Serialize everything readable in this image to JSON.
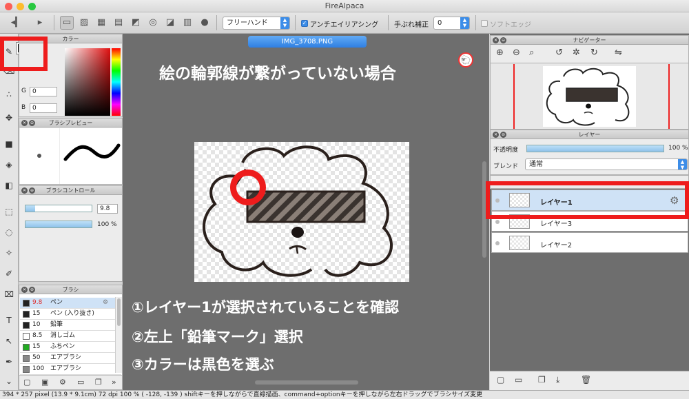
{
  "app": {
    "title": "FireAlpaca"
  },
  "toolbar": {
    "brush_mode": "フリーハンド",
    "antialias_label": "アンチエイリアシング",
    "stabilizer_label": "手ぶれ補正",
    "stabilizer_value": "0",
    "soft_edge_label": "ソフトエッジ"
  },
  "color_panel": {
    "title": "カラー",
    "g_label": "G",
    "g_value": "0",
    "b_label": "B",
    "b_value": "0",
    "foreground": "#000000",
    "background": "#ffffff"
  },
  "brush_preview": {
    "title": "ブラシプレビュー"
  },
  "brush_control": {
    "title": "ブラシコントロール",
    "size_value": "9.8",
    "opacity_value": "100 %",
    "size_level": 0.15,
    "opacity_level": 1.0
  },
  "brush_panel": {
    "title": "ブラシ",
    "items": [
      {
        "size": "9.8",
        "name": "ペン",
        "color": "#222222"
      },
      {
        "size": "15",
        "name": "ペン (入り抜き)",
        "color": "#222222"
      },
      {
        "size": "10",
        "name": "鉛筆",
        "color": "#222222"
      },
      {
        "size": "8.5",
        "name": "消しゴム",
        "color": "#ffffff"
      },
      {
        "size": "15",
        "name": "ふちペン",
        "color": "#22aa22"
      },
      {
        "size": "50",
        "name": "エアブラシ",
        "color": "#888888"
      },
      {
        "size": "100",
        "name": "エアブラシ",
        "color": "#888888"
      }
    ]
  },
  "canvas": {
    "tab_label": "IMG_3708.PNG",
    "heading": "絵の輪郭線が繋がっていない場合",
    "steps": [
      "①レイヤー1が選択されていることを確認",
      "②左上「鉛筆マーク」選択",
      "③カラーは黒色を選ぶ"
    ]
  },
  "navigator": {
    "title": "ナビゲーター"
  },
  "layers": {
    "title": "レイヤー",
    "opacity_label": "不透明度",
    "opacity_value": "100 %",
    "blend_label": "ブレンド",
    "blend_value": "通常",
    "items": [
      {
        "name": "レイヤー1",
        "selected": true
      },
      {
        "name": "レイヤー3",
        "selected": false
      },
      {
        "name": "レイヤー2",
        "selected": false
      }
    ]
  },
  "status": {
    "text": "394 * 257 pixel   (13.9 * 9.1cm)   72 dpi   100 %   ( -128, -139 )   shiftキーを押しながらで直線描画、command+optionキーを押しながら左右ドラッグでブラシサイズ変更"
  },
  "accent": {
    "highlight_red": "#ee1c1c",
    "selection_blue": "#3c8de8"
  }
}
